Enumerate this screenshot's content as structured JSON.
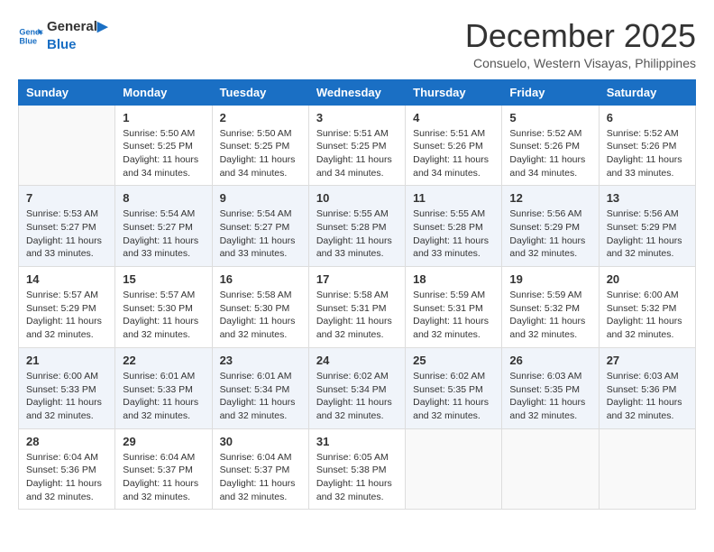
{
  "header": {
    "logo_line1": "General",
    "logo_line2": "Blue",
    "month": "December 2025",
    "location": "Consuelo, Western Visayas, Philippines"
  },
  "days_of_week": [
    "Sunday",
    "Monday",
    "Tuesday",
    "Wednesday",
    "Thursday",
    "Friday",
    "Saturday"
  ],
  "weeks": [
    [
      {
        "day": "",
        "info": ""
      },
      {
        "day": "1",
        "info": "Sunrise: 5:50 AM\nSunset: 5:25 PM\nDaylight: 11 hours\nand 34 minutes."
      },
      {
        "day": "2",
        "info": "Sunrise: 5:50 AM\nSunset: 5:25 PM\nDaylight: 11 hours\nand 34 minutes."
      },
      {
        "day": "3",
        "info": "Sunrise: 5:51 AM\nSunset: 5:25 PM\nDaylight: 11 hours\nand 34 minutes."
      },
      {
        "day": "4",
        "info": "Sunrise: 5:51 AM\nSunset: 5:26 PM\nDaylight: 11 hours\nand 34 minutes."
      },
      {
        "day": "5",
        "info": "Sunrise: 5:52 AM\nSunset: 5:26 PM\nDaylight: 11 hours\nand 34 minutes."
      },
      {
        "day": "6",
        "info": "Sunrise: 5:52 AM\nSunset: 5:26 PM\nDaylight: 11 hours\nand 33 minutes."
      }
    ],
    [
      {
        "day": "7",
        "info": "Sunrise: 5:53 AM\nSunset: 5:27 PM\nDaylight: 11 hours\nand 33 minutes."
      },
      {
        "day": "8",
        "info": "Sunrise: 5:54 AM\nSunset: 5:27 PM\nDaylight: 11 hours\nand 33 minutes."
      },
      {
        "day": "9",
        "info": "Sunrise: 5:54 AM\nSunset: 5:27 PM\nDaylight: 11 hours\nand 33 minutes."
      },
      {
        "day": "10",
        "info": "Sunrise: 5:55 AM\nSunset: 5:28 PM\nDaylight: 11 hours\nand 33 minutes."
      },
      {
        "day": "11",
        "info": "Sunrise: 5:55 AM\nSunset: 5:28 PM\nDaylight: 11 hours\nand 33 minutes."
      },
      {
        "day": "12",
        "info": "Sunrise: 5:56 AM\nSunset: 5:29 PM\nDaylight: 11 hours\nand 32 minutes."
      },
      {
        "day": "13",
        "info": "Sunrise: 5:56 AM\nSunset: 5:29 PM\nDaylight: 11 hours\nand 32 minutes."
      }
    ],
    [
      {
        "day": "14",
        "info": "Sunrise: 5:57 AM\nSunset: 5:29 PM\nDaylight: 11 hours\nand 32 minutes."
      },
      {
        "day": "15",
        "info": "Sunrise: 5:57 AM\nSunset: 5:30 PM\nDaylight: 11 hours\nand 32 minutes."
      },
      {
        "day": "16",
        "info": "Sunrise: 5:58 AM\nSunset: 5:30 PM\nDaylight: 11 hours\nand 32 minutes."
      },
      {
        "day": "17",
        "info": "Sunrise: 5:58 AM\nSunset: 5:31 PM\nDaylight: 11 hours\nand 32 minutes."
      },
      {
        "day": "18",
        "info": "Sunrise: 5:59 AM\nSunset: 5:31 PM\nDaylight: 11 hours\nand 32 minutes."
      },
      {
        "day": "19",
        "info": "Sunrise: 5:59 AM\nSunset: 5:32 PM\nDaylight: 11 hours\nand 32 minutes."
      },
      {
        "day": "20",
        "info": "Sunrise: 6:00 AM\nSunset: 5:32 PM\nDaylight: 11 hours\nand 32 minutes."
      }
    ],
    [
      {
        "day": "21",
        "info": "Sunrise: 6:00 AM\nSunset: 5:33 PM\nDaylight: 11 hours\nand 32 minutes."
      },
      {
        "day": "22",
        "info": "Sunrise: 6:01 AM\nSunset: 5:33 PM\nDaylight: 11 hours\nand 32 minutes."
      },
      {
        "day": "23",
        "info": "Sunrise: 6:01 AM\nSunset: 5:34 PM\nDaylight: 11 hours\nand 32 minutes."
      },
      {
        "day": "24",
        "info": "Sunrise: 6:02 AM\nSunset: 5:34 PM\nDaylight: 11 hours\nand 32 minutes."
      },
      {
        "day": "25",
        "info": "Sunrise: 6:02 AM\nSunset: 5:35 PM\nDaylight: 11 hours\nand 32 minutes."
      },
      {
        "day": "26",
        "info": "Sunrise: 6:03 AM\nSunset: 5:35 PM\nDaylight: 11 hours\nand 32 minutes."
      },
      {
        "day": "27",
        "info": "Sunrise: 6:03 AM\nSunset: 5:36 PM\nDaylight: 11 hours\nand 32 minutes."
      }
    ],
    [
      {
        "day": "28",
        "info": "Sunrise: 6:04 AM\nSunset: 5:36 PM\nDaylight: 11 hours\nand 32 minutes."
      },
      {
        "day": "29",
        "info": "Sunrise: 6:04 AM\nSunset: 5:37 PM\nDaylight: 11 hours\nand 32 minutes."
      },
      {
        "day": "30",
        "info": "Sunrise: 6:04 AM\nSunset: 5:37 PM\nDaylight: 11 hours\nand 32 minutes."
      },
      {
        "day": "31",
        "info": "Sunrise: 6:05 AM\nSunset: 5:38 PM\nDaylight: 11 hours\nand 32 minutes."
      },
      {
        "day": "",
        "info": ""
      },
      {
        "day": "",
        "info": ""
      },
      {
        "day": "",
        "info": ""
      }
    ]
  ]
}
